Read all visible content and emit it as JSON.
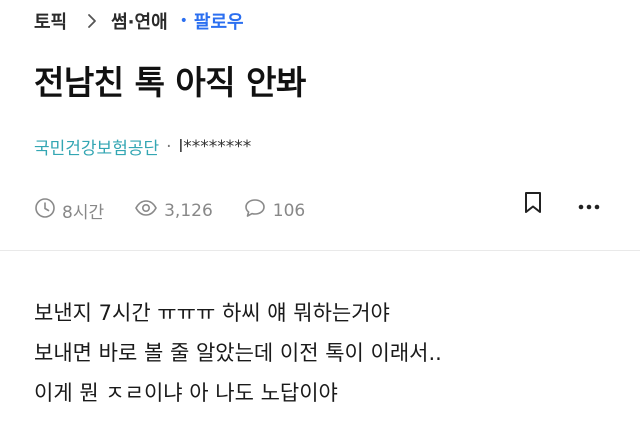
{
  "breadcrumb": {
    "topic": "토픽",
    "separator": ">",
    "category": "썸·연애",
    "dot": "•",
    "follow": "팔로우"
  },
  "post": {
    "title": "전남친 톡 아직 안봐",
    "author": {
      "company": "국민건강보험공단",
      "separator": "·",
      "nickname": "l********"
    },
    "stats": {
      "time": "8시간",
      "views": "3,126",
      "comments": "106"
    },
    "body": [
      "보낸지 7시간 ㅠㅠㅠ 하씨 얘 뭐하는거야",
      "보내면 바로 볼 줄 알았는데 이전 톡이 이래서..",
      "이게 뭔 ㅈㄹ이냐 아 나도 노답이야"
    ]
  },
  "icons": {
    "chevron": "chevron-right-icon",
    "clock": "clock-icon",
    "eye": "eye-icon",
    "comment": "comment-icon",
    "bookmark": "bookmark-icon",
    "more": "more-horizontal-icon"
  },
  "colors": {
    "accent": "#2b6ff0",
    "company": "#33a6b3",
    "muted": "#888888"
  }
}
